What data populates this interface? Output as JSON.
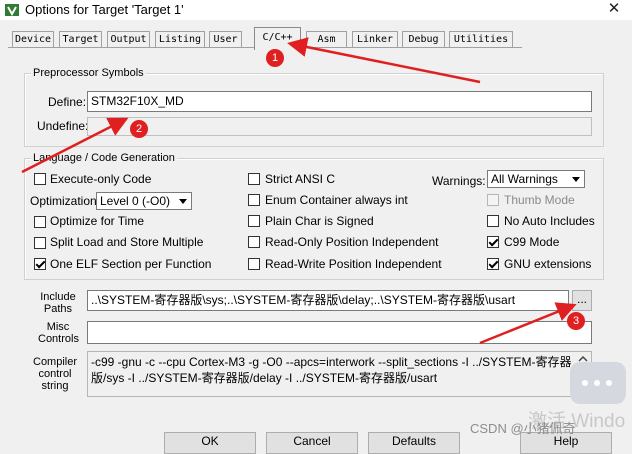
{
  "window": {
    "title": "Options for Target 'Target 1'",
    "close_glyph": "✕"
  },
  "tabs": [
    {
      "label": "Device"
    },
    {
      "label": "Target"
    },
    {
      "label": "Output"
    },
    {
      "label": "Listing"
    },
    {
      "label": "User"
    },
    {
      "label": "C/C++",
      "active": true
    },
    {
      "label": "Asm"
    },
    {
      "label": "Linker"
    },
    {
      "label": "Debug"
    },
    {
      "label": "Utilities"
    }
  ],
  "preprocessor": {
    "legend": "Preprocessor Symbols",
    "define_label": "Define:",
    "define_value": "STM32F10X_MD",
    "undefine_label": "Undefine:",
    "undefine_value": ""
  },
  "language": {
    "legend": "Language / Code Generation",
    "execute_only": {
      "label": "Execute-only Code",
      "checked": false
    },
    "optimization_label": "Optimization:",
    "optimization_value": "Level 0 (-O0)",
    "optimize_time": {
      "label": "Optimize for Time",
      "checked": false
    },
    "split_load": {
      "label": "Split Load and Store Multiple",
      "checked": false
    },
    "one_elf": {
      "label": "One ELF Section per Function",
      "checked": true
    },
    "strict_ansi": {
      "label": "Strict ANSI C",
      "checked": false
    },
    "enum_container": {
      "label": "Enum Container always int",
      "checked": false
    },
    "plain_char": {
      "label": "Plain Char is Signed",
      "checked": false
    },
    "ro_position": {
      "label": "Read-Only Position Independent",
      "checked": false
    },
    "rw_position": {
      "label": "Read-Write Position Independent",
      "checked": false
    },
    "warnings_label": "Warnings:",
    "warnings_value": "All Warnings",
    "thumb_mode": {
      "label": "Thumb Mode",
      "checked": false,
      "disabled": true
    },
    "no_auto_includes": {
      "label": "No Auto Includes",
      "checked": false
    },
    "c99_mode": {
      "label": "C99 Mode",
      "checked": true
    },
    "gnu_extensions": {
      "label": "GNU extensions",
      "checked": true
    }
  },
  "paths": {
    "include_label": "Include\nPaths",
    "include_value": "..\\SYSTEM-寄存器版\\sys;..\\SYSTEM-寄存器版\\delay;..\\SYSTEM-寄存器版\\usart",
    "browse_label": "...",
    "misc_label": "Misc\nControls",
    "misc_value": "",
    "compiler_label": "Compiler\ncontrol\nstring",
    "compiler_value": "-c99 -gnu -c --cpu Cortex-M3 -g -O0 --apcs=interwork --split_sections -I ../SYSTEM-寄存器版/sys -I ../SYSTEM-寄存器版/delay -I ../SYSTEM-寄存器版/usart"
  },
  "buttons": {
    "ok": "OK",
    "cancel": "Cancel",
    "defaults": "Defaults",
    "help": "Help"
  },
  "annotations": {
    "marker_1": "1",
    "marker_2": "2",
    "marker_3": "3",
    "color": "#e02020"
  },
  "watermark": {
    "text": "CSDN @小猪佩奇",
    "overlay": "激活 Windo"
  }
}
